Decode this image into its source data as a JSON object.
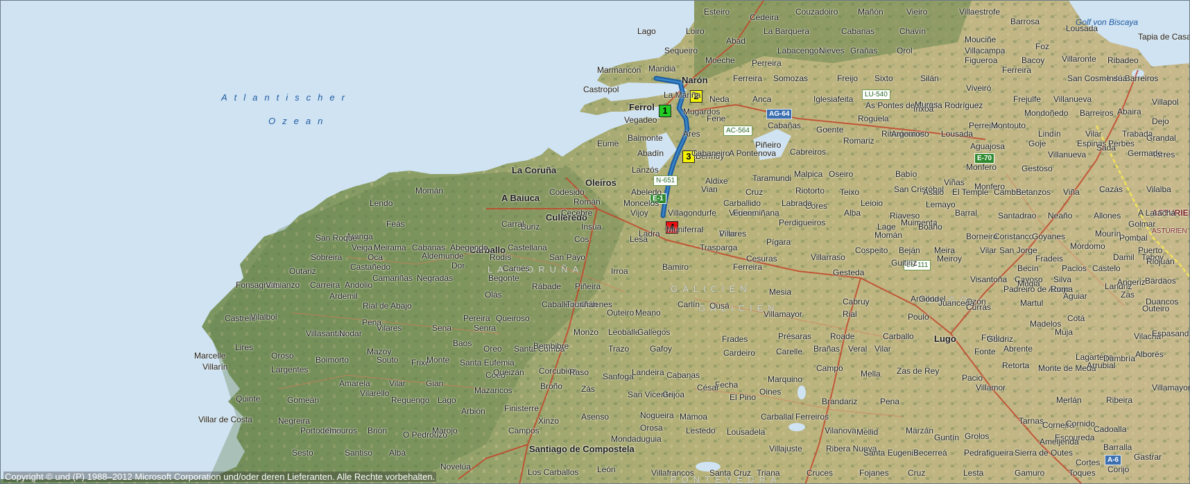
{
  "map": {
    "sea_labels": {
      "ocean_line1": "Atlantischer",
      "ocean_line2": "Ozean",
      "bay": "Golf von Biscaya"
    },
    "region_labels": [
      "LA CORUÑA",
      "GALICIEN",
      "GALICIEN",
      "LUGO",
      "PONTEVEDRA",
      "ASTURIEN",
      "ASTURIEN"
    ],
    "route": {
      "color": "#1f5fa0",
      "stops": [
        "1",
        "2",
        "3",
        "4"
      ]
    },
    "markers": [
      {
        "label": "1",
        "color": "green"
      },
      {
        "label": "2",
        "color": "yellow"
      },
      {
        "label": "3",
        "color": "yellow"
      },
      {
        "label": "4",
        "color": "red"
      }
    ],
    "road_shields": [
      "AG-64",
      "AC-564",
      "LU-540",
      "N-651",
      "E-1",
      "E-70",
      "LU-111",
      "A-6"
    ],
    "major_cities": [
      "La Coruña",
      "Ferrol",
      "Narón",
      "Oleiros",
      "Culleredo",
      "A Baiuca",
      "Carballo",
      "Lugo",
      "Santiago de Compostela"
    ],
    "places": [
      "Esteiro",
      "Cedeira",
      "Couzadoiro",
      "Mañón",
      "Vieiro",
      "Villaestrofe",
      "Barrosa",
      "Lousada",
      "Lago",
      "Loiro",
      "La Barquera",
      "Cabanas",
      "Chavín",
      "Mouciñe",
      "Tapia de Casariego",
      "Abad",
      "Labacengos",
      "Nieves",
      "Grañas",
      "Orol",
      "Villacampa",
      "Foz",
      "Villaronte",
      "Ribadeo",
      "Sequeiro",
      "Moeche",
      "Perreira",
      "Figueroa",
      "Bacoy",
      "Marmancón",
      "Mandiá",
      "Ferreira",
      "Somozas",
      "Freijo",
      "Sixto",
      "Silán",
      "Ferreira",
      "San Cosme de Barreiros",
      "Insúa",
      "Castropol",
      "La Mariña",
      "Neda",
      "Anca",
      "Iglesiafeita",
      "As Pontes de García Rodríguez",
      "Muras",
      "Viveiró",
      "Frejulfe",
      "Villanueva",
      "Villapol",
      "Vegadeo",
      "Mugardos",
      "Fene",
      "Roguela",
      "Irixoa",
      "Perreiro",
      "Mondoñedo",
      "Barreiros",
      "Abaira",
      "Balmonte",
      "Ares",
      "Cabañas",
      "Goente",
      "Ribadeume",
      "Lousada",
      "Montouto",
      "Lindín",
      "Vilar",
      "Trabada",
      "Dejo",
      "Eume",
      "Bermuy",
      "Piñeiro",
      "Cabreiros",
      "Romariz",
      "Argomoso",
      "Aguajosa",
      "Goje",
      "Espinas",
      "Perbes",
      "Grandal",
      "Abadín",
      "Cabaneiro",
      "A Pontenova",
      "Villanueva",
      "Sada",
      "Torres",
      "Monfero",
      "Gestoso",
      "Germade",
      "Lanzós",
      "Aldixe",
      "Taramundi",
      "Malpica",
      "Oseiro",
      "Babío",
      "Viñas",
      "Monfero",
      "Momán",
      "Codesido",
      "Abeledo",
      "Vian",
      "Cruz",
      "Riotorto",
      "Teixo",
      "San Cristóbal",
      "Asalo",
      "El Temple",
      "Cambre",
      "Betanzos",
      "Viña",
      "Cazás",
      "Vilalba",
      "Román",
      "Moncelos",
      "Villagondurfe",
      "Carballido",
      "Cores",
      "Leioio",
      "Lemayo",
      "Lendo",
      "Cecebre",
      "Vijoy",
      "Verines",
      "Labrada",
      "Alba",
      "Riaveso",
      "Muimenta",
      "Barral",
      "Santadrao",
      "Neaño",
      "Allones",
      "A Laracha",
      "Feás",
      "Aranga",
      "Buriz",
      "Insúa",
      "Ladra",
      "Pino",
      "Fuenmiñana",
      "Perdigueiros",
      "Lage",
      "Boaño",
      "Borneiro",
      "Coristanco",
      "Goyanes",
      "Golmar",
      "Veiga",
      "Carral",
      "Cos",
      "Lesa",
      "Muniferral",
      "Villares",
      "Momán",
      "Meira",
      "Vilar",
      "Mórdomo",
      "Pombal",
      "San Roque",
      "Meirama",
      "Cabanas",
      "Abegondo",
      "Castellana",
      "Trasparga",
      "Pígara",
      "Cospeito",
      "Beján",
      "Meiroy",
      "San Jorge",
      "Fradeis",
      "Mourín",
      "Puerto",
      "Sobreira",
      "Oca",
      "Aldemunde",
      "Rodís",
      "San Payo",
      "Cesuras",
      "Villarraso",
      "Guitiriz",
      "Becín",
      "Pacios",
      "Damil",
      "Taboy",
      "Riojuán",
      "Outariz",
      "Castañedo",
      "Camariñas",
      "Dor",
      "Carnés",
      "Irroa",
      "Bamiro",
      "Ferreira",
      "Gesteda",
      "Visantoña",
      "Cayoso",
      "Silva",
      "Landriz",
      "Fonsagrada",
      "Vimianzo",
      "Carreira",
      "Andolio",
      "Negradas",
      "Begonte",
      "Rábade",
      "Piñeira",
      "Armilda",
      "Mugia",
      "Castelo",
      "Angeriz",
      "Bardaos",
      "Ardemil",
      "Olás",
      "Mesia",
      "Cabruy",
      "Gondel",
      "Ozón",
      "Padreiro de Abajo",
      "Roma",
      "Zas",
      "Rial de Abajo",
      "Caballeiros",
      "Ordenes",
      "Carlín",
      "Ousá",
      "Martul",
      "Aguiar",
      "Duancos",
      "Castrelo",
      "Vilalbol",
      "Villasantar",
      "Nodar",
      "Pena",
      "Pereira",
      "Queiroso",
      "Touriñán",
      "Outeiro",
      "Meano",
      "Villamayor",
      "Rial",
      "Poulo",
      "Juanceda",
      "Currás",
      "Madelos",
      "Cotá",
      "Outeiro",
      "Mazoy",
      "Vilares",
      "Sena",
      "Senra",
      "Monzo",
      "Leoballe",
      "Gallegos",
      "Frades",
      "Présaras",
      "Roade",
      "Carballo",
      "Friol",
      "Guldriz",
      "Muja",
      "Vilachá",
      "Espasande",
      "Lires",
      "Frixe",
      "Baos",
      "Oreo",
      "Santa Comba",
      "Bembibre",
      "Trazo",
      "Gafoy",
      "Cardeiro",
      "Carelle",
      "Brañas",
      "Veral",
      "Vilar",
      "Fonte",
      "Abrente",
      "Lagarteira",
      "Dumbría",
      "Alborés",
      "Marcelle",
      "Oroso",
      "Boimorto",
      "Souto",
      "Monte",
      "Santa Eufemia",
      "Coeo",
      "Queizán",
      "Corcubión",
      "Raso",
      "Sanfoga",
      "Landeira",
      "Cabanas",
      "Fecha",
      "Marquino",
      "Campo",
      "Mella",
      "Zas de Rey",
      "Pacio",
      "Retorta",
      "Monte de Meda",
      "Arrubial",
      "Villarín",
      "Largentes",
      "Amarela",
      "Vilar",
      "Gian",
      "Mazaricos",
      "Broño",
      "Zás",
      "San Vicente",
      "Grijoa",
      "César",
      "El Pino",
      "Oines",
      "Brandariz",
      "Pena",
      "Villamor",
      "Merlán",
      "Ribeira",
      "Villamayor de Negral",
      "Quinte",
      "Gomeán",
      "Vilarello",
      "Reguengo",
      "Lago",
      "Arbión",
      "Finisterre",
      "Xinzo",
      "Asenso",
      "Nogueira",
      "Mámoa",
      "Carballal",
      "Ferreiros",
      "Vilanova",
      "Mellid",
      "Marzán",
      "Guntín",
      "Grolos",
      "Escoureda",
      "Barralla",
      "Cadoalla",
      "Tarnas",
      "Corneira",
      "Cornido",
      "Villar de Costa",
      "Negreira",
      "Ons",
      "Brión",
      "O Pedrouzo",
      "Marojo",
      "Campos",
      "Mondaduguia",
      "Orosa",
      "Lestedo",
      "Lousadela",
      "Villajuste",
      "Ribera Nueva",
      "Santa Eugenia",
      "Becerreá",
      "Pedrafigueira",
      "Ameijenda",
      "Sierra de Outes",
      "Cortes",
      "Corijo",
      "Gastrar",
      "Portodemouros",
      "Sesto",
      "Santiso",
      "Albá",
      "Novelúa",
      "Los Carballos",
      "León",
      "Villafrancos",
      "Santa Cruz",
      "Triana",
      "Cruces",
      "Fojanes",
      "Cruz",
      "Lesta",
      "Gamuro",
      "Toques"
    ],
    "copyright": "Copyright © und (P) 1988–2012 Microsoft Corporation und/oder deren Lieferanten. Alle Rechte vorbehalten."
  }
}
